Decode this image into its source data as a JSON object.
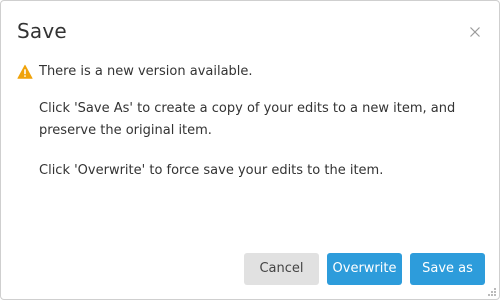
{
  "dialog": {
    "title": "Save",
    "close_icon": "close-icon",
    "warning": {
      "icon": "warning-icon",
      "icon_color": "#f0a30a",
      "text": "There is a new version available."
    },
    "paragraphs": [
      "Click 'Save As' to create a copy of your edits to a new item, and preserve the original item.",
      "Click 'Overwrite' to force save your edits to the item."
    ],
    "buttons": {
      "cancel_label": "Cancel",
      "overwrite_label": "Overwrite",
      "save_as_label": "Save as"
    },
    "resize_icon": "resize-grip-icon"
  },
  "colors": {
    "primary": "#2d9cdb",
    "secondary_button_bg": "#e1e1e1",
    "text": "#333333",
    "border": "#cfcfcf"
  }
}
